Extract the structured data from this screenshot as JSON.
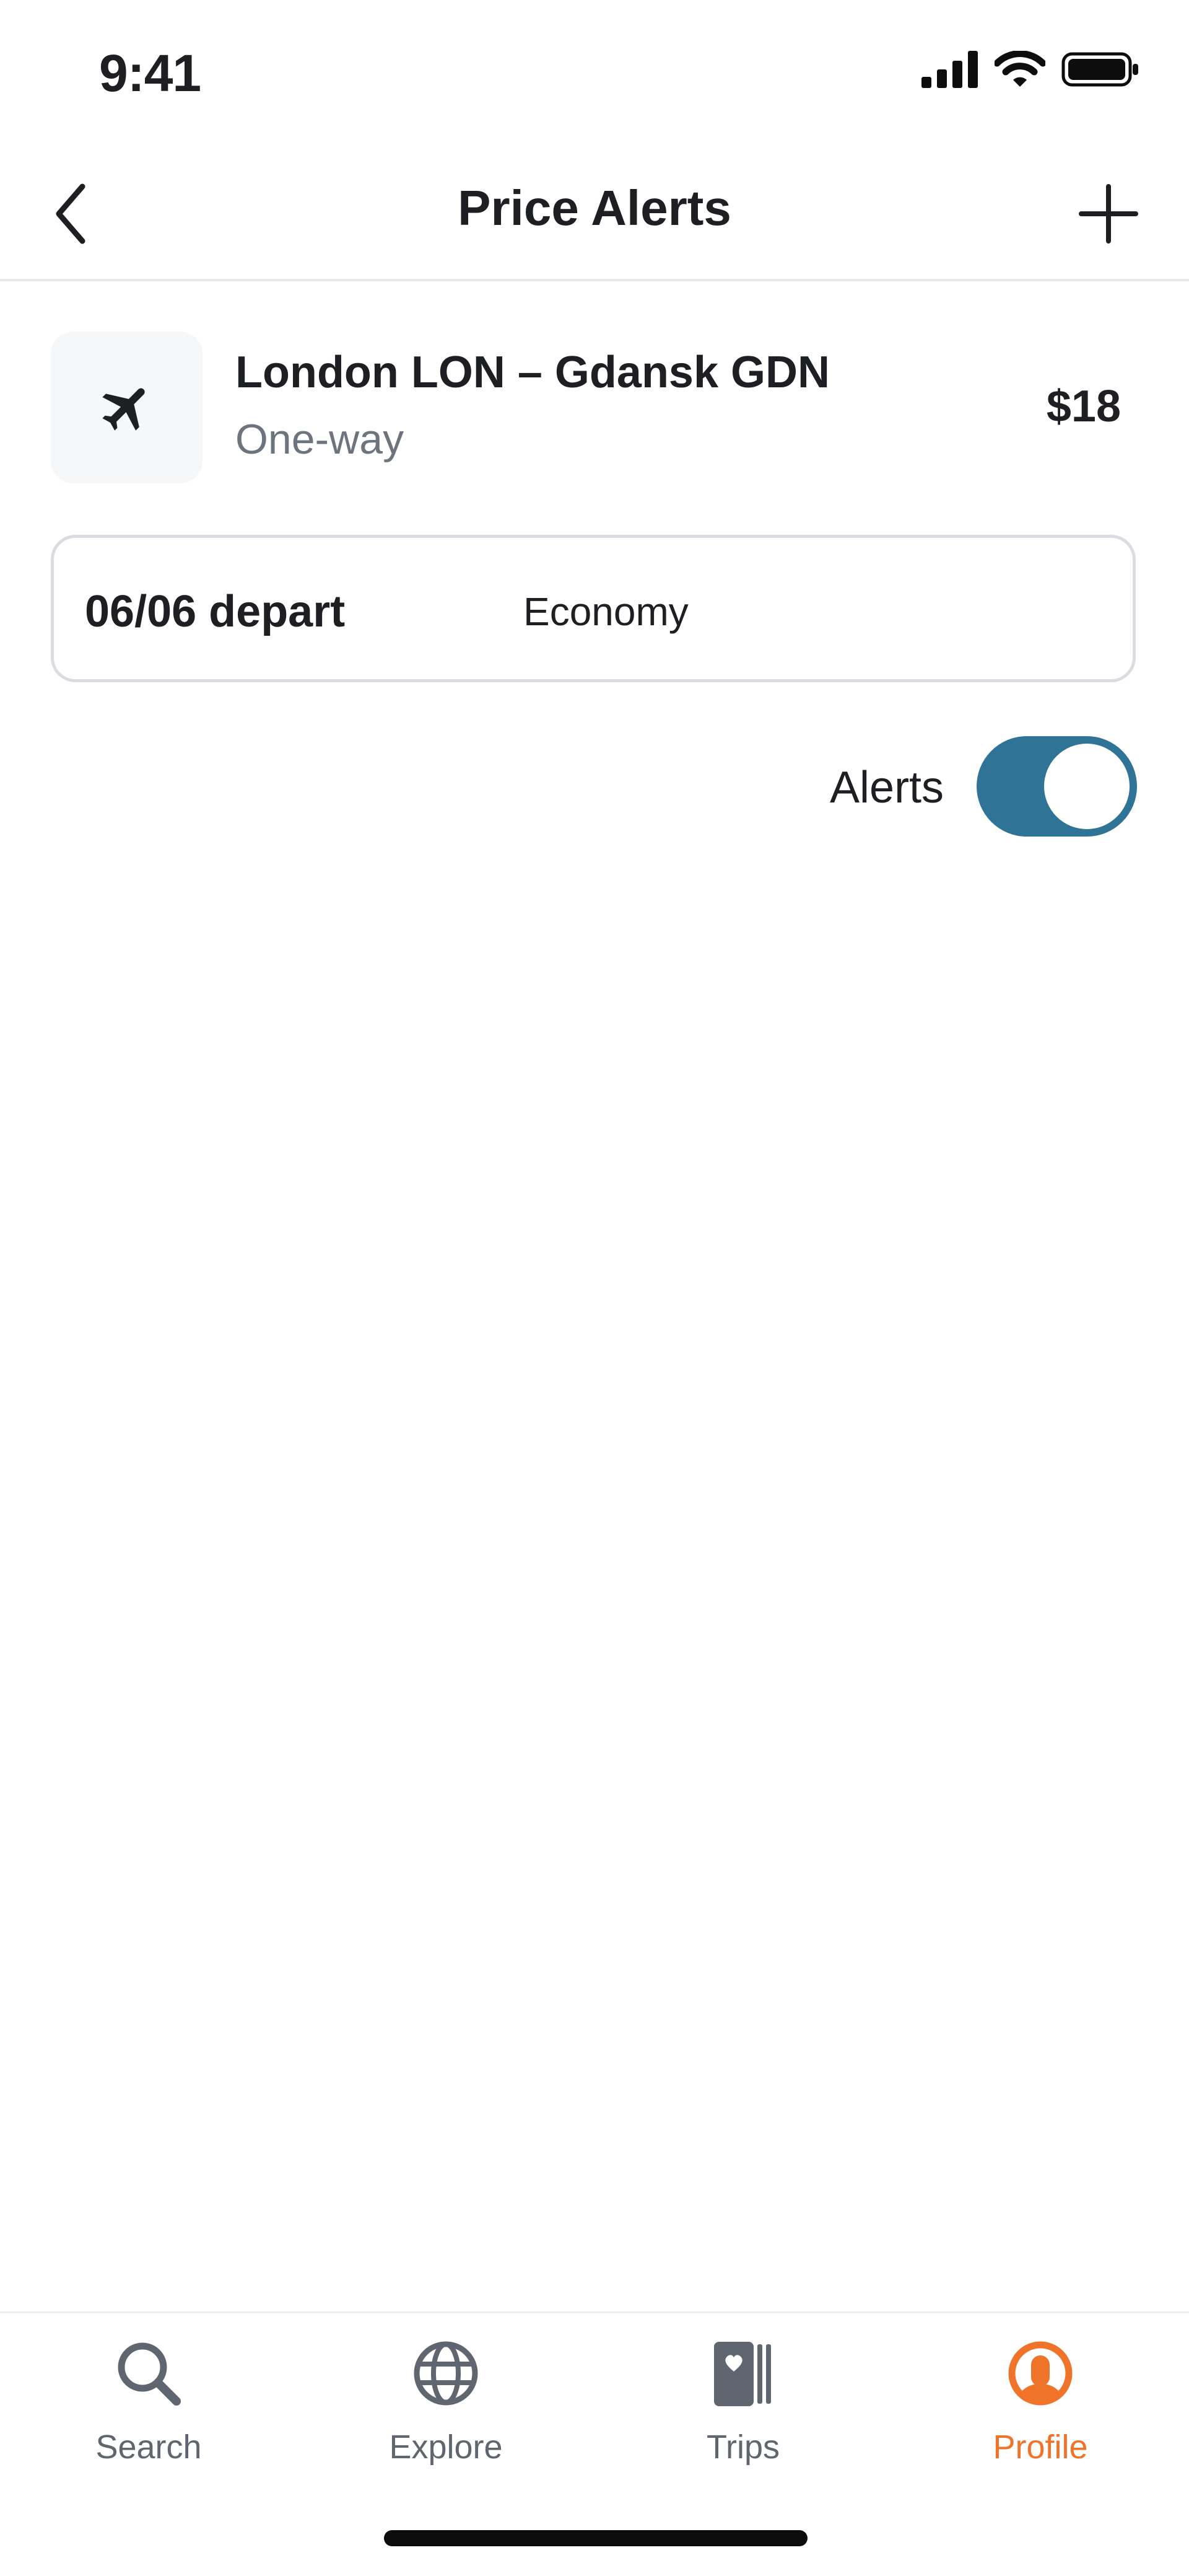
{
  "status_bar": {
    "time": "9:41",
    "icons": [
      "cellular-signal-icon",
      "wifi-icon",
      "battery-icon"
    ]
  },
  "header": {
    "title": "Price Alerts",
    "back_icon": "chevron-left-icon",
    "add_icon": "plus-icon"
  },
  "alert": {
    "icon": "airplane-icon",
    "route": "London LON – Gdansk GDN",
    "trip_type": "One-way",
    "price": "$18",
    "date": "06/06 depart",
    "cabin": "Economy",
    "alerts_label": "Alerts",
    "alerts_enabled": true
  },
  "bottom_nav": {
    "items": [
      {
        "label": "Search",
        "icon": "search-icon",
        "active": false
      },
      {
        "label": "Explore",
        "icon": "globe-icon",
        "active": false
      },
      {
        "label": "Trips",
        "icon": "trips-icon",
        "active": false
      },
      {
        "label": "Profile",
        "icon": "profile-icon",
        "active": true
      }
    ]
  },
  "colors": {
    "accent_active": "#f0732a",
    "toggle_on": "#2f7396",
    "text_primary": "#1d1f22",
    "text_secondary": "#6d747d"
  }
}
